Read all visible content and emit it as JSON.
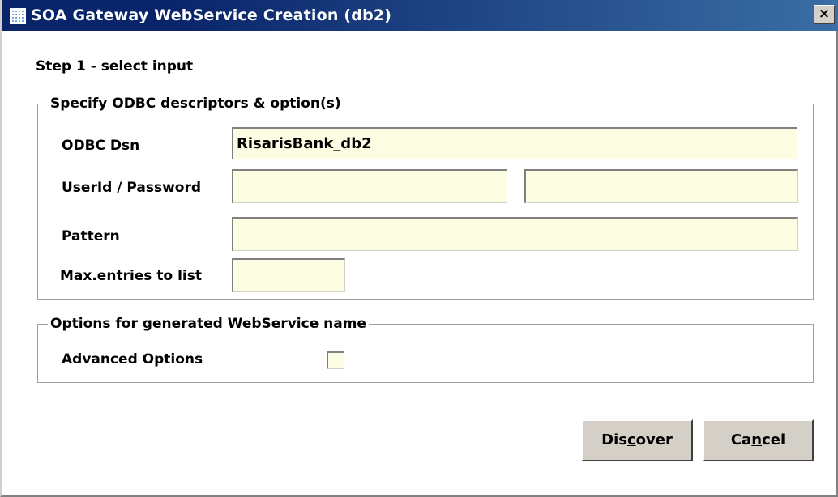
{
  "window": {
    "title": "SOA Gateway WebService Creation (db2)",
    "close_symbol": "×",
    "icon": "soa-gateway-app-icon"
  },
  "step_label": "Step 1 - select input",
  "odbc_group": {
    "legend": "Specify ODBC descriptors & option(s)",
    "dsn_label": "ODBC Dsn",
    "dsn_value": "RisarisBank_db2",
    "userid_password_label": "UserId / Password",
    "userid_value": "",
    "password_value": "",
    "pattern_label": "Pattern",
    "pattern_value": "",
    "max_entries_label": "Max.entries to list",
    "max_entries_value": ""
  },
  "options_group": {
    "legend": "Options for generated WebService name",
    "advanced_label": "Advanced Options",
    "advanced_checked": false
  },
  "buttons": {
    "discover": {
      "pre": "Dis",
      "mnemonic": "c",
      "post": "over"
    },
    "cancel": {
      "pre": "Ca",
      "mnemonic": "n",
      "post": "cel"
    }
  },
  "colors": {
    "titlebar": "#0a246a",
    "field_bg": "#fdfde3",
    "button_face": "#d4d0c8"
  }
}
